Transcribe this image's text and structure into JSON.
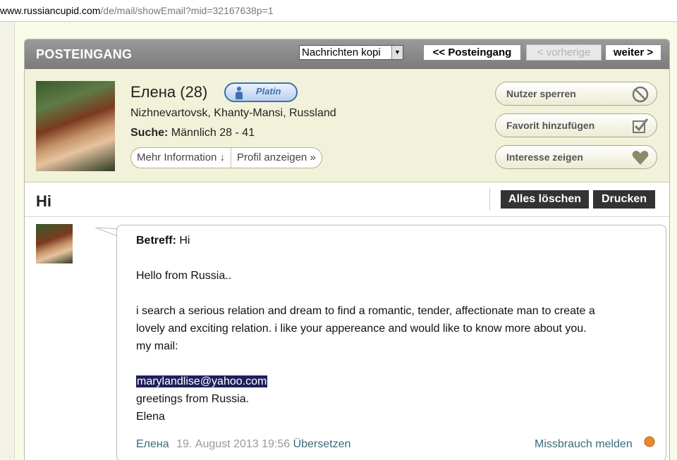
{
  "browser": {
    "url_host": "www.russiancupid.com",
    "url_path": "/de/mail/showEmail?mid=32167638p=1"
  },
  "header": {
    "title": "POSTEINGANG",
    "move_select_value": "Nachrichten kopi",
    "back_to_inbox_label": "<< Posteingang",
    "previous_label": "< vorherige",
    "next_label": "weiter >"
  },
  "profile": {
    "name": "Елена (28)",
    "membership_badge": "Platin",
    "location": "Nizhnevartovsk, Khanty-Mansi, Russland",
    "search_label": "Suche:",
    "search_value": "Männlich 28 - 41",
    "more_info_label": "Mehr Information ↓",
    "view_profile_label": "Profil anzeigen »",
    "actions": [
      {
        "label": "Nutzer sperren",
        "icon": "block-icon"
      },
      {
        "label": "Favorit hinzufügen",
        "icon": "checkbox-icon"
      },
      {
        "label": "Interesse zeigen",
        "icon": "heart-icon"
      }
    ]
  },
  "message_header": {
    "subject_title": "Hi",
    "delete_all_label": "Alles löschen",
    "print_label": "Drucken"
  },
  "message": {
    "subject_label": "Betreff:",
    "subject_value": "Hi",
    "greeting": "Hello from Russia..",
    "body_line1": "i search a serious relation and dream to find a romantic, tender, affectionate man to create a",
    "body_line2": "lovely and exciting relation. i like your appereance and would like to know more about you.",
    "body_line3": "my mail:",
    "email": "marylandlise@yahoo.com",
    "closing1": "greetings from Russia.",
    "closing2": "Elena",
    "sender_name": "Елена",
    "timestamp": "19. August 2013 19:56",
    "translate_label": "Übersetzen",
    "report_label": "Missbrauch melden"
  },
  "colors": {
    "link": "#3a6a7a",
    "header_gray": "#8a8a8a",
    "profile_bg": "#f2f1d9",
    "badge_blue": "#3f6fb0",
    "dark_button": "#333333"
  }
}
